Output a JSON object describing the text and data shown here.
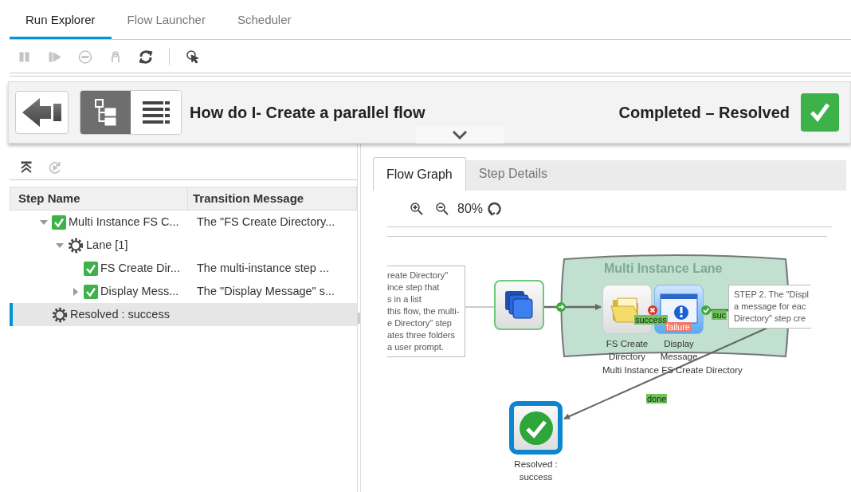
{
  "tabs": [
    {
      "label": "Run Explorer",
      "selected": true
    },
    {
      "label": "Flow Launcher",
      "selected": false
    },
    {
      "label": "Scheduler",
      "selected": false
    }
  ],
  "toolbar": [
    {
      "kind": "pause",
      "disabled": true
    },
    {
      "kind": "resume",
      "disabled": true
    },
    {
      "kind": "cancel",
      "disabled": true
    },
    {
      "kind": "reassign",
      "disabled": true
    },
    {
      "kind": "refresh",
      "disabled": false
    },
    {
      "kind": "pointer",
      "disabled": false
    }
  ],
  "run_header": {
    "views": [
      {
        "kind": "tree",
        "selected": true
      },
      {
        "kind": "list",
        "selected": false
      }
    ],
    "title": "How do I- Create a parallel flow",
    "status": "Completed – Resolved"
  },
  "step_tree": {
    "toolbar": [
      {
        "kind": "collapse",
        "disabled": false
      },
      {
        "kind": "replay",
        "disabled": true
      }
    ],
    "columns": [
      "Step Name",
      "Transition Message"
    ],
    "rows": [
      {
        "kind": "step",
        "name": "Multi Instance FS C...",
        "message": "The \"FS Create Directory...",
        "expanded": true,
        "selected": false,
        "children": [
          {
            "kind": "group",
            "name": "Lane [1]",
            "expanded": true,
            "selected": false,
            "children": [
              {
                "kind": "step",
                "name": "FS Create Dir...",
                "message": "The multi-instance step ...",
                "selected": false
              },
              {
                "kind": "step",
                "name": "Display Mess...",
                "message": "The \"Display Message\" s...",
                "expanded": false,
                "selected": false
              }
            ]
          }
        ]
      },
      {
        "kind": "group",
        "name": "Resolved : success",
        "selected": true
      }
    ]
  },
  "flow_panel": {
    "tabs": [
      {
        "label": "Flow Graph",
        "selected": true
      },
      {
        "label": "Step Details",
        "selected": false
      }
    ],
    "zoom": "80%",
    "graph": {
      "notes": [
        {
          "lines": [
            "reate Directory\"",
            "ince step that",
            "s in a list",
            "this flow, the multi-",
            "e Directory\" step",
            "ates three folders",
            "a user prompt."
          ]
        },
        {
          "lines": [
            "STEP 2. The \"Displ",
            "a message for eac",
            "Directory\" step cre"
          ]
        }
      ],
      "lane": {
        "title": "Multi Instance Lane",
        "caption": "Multi Instance FS Create Directory"
      },
      "nodes": [
        {
          "kind": "start"
        },
        {
          "kind": "folder",
          "label": "FS Create Directory"
        },
        {
          "kind": "message",
          "label": "Display Message"
        },
        {
          "kind": "resolved",
          "label": "Resolved : success"
        }
      ],
      "edge_labels": [
        {
          "kind": "success",
          "text": "success"
        },
        {
          "kind": "failure",
          "text": "failure"
        },
        {
          "kind": "success",
          "text": "suc"
        },
        {
          "kind": "success",
          "text": "done"
        }
      ]
    }
  }
}
